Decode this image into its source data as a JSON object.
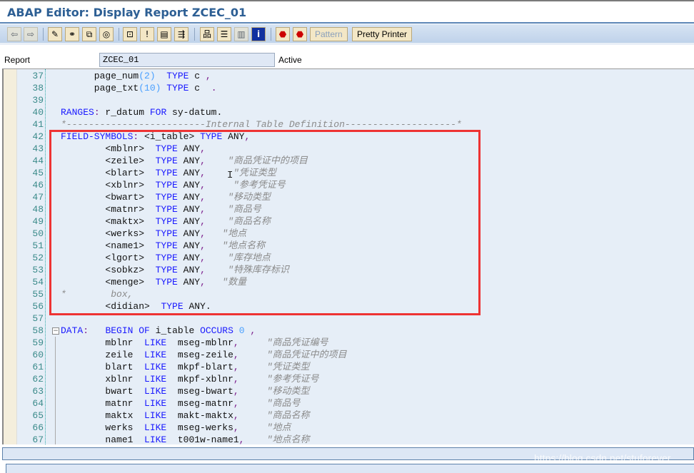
{
  "window": {
    "title": "ABAP Editor: Display Report ZCEC_01"
  },
  "toolbar": {
    "icons": [
      "back-icon",
      "forward-icon",
      "display-change-icon",
      "active-inactive-icon",
      "other-object-icon",
      "where-used-icon",
      "hierarchy-icon",
      "breakpoint-icon",
      "display-object-list-icon",
      "navigation-icon",
      "object-tree-icon",
      "stack-icon",
      "layout-icon",
      "info-icon",
      "stop-icon",
      "user-stop-icon"
    ],
    "pattern_label": "Pattern",
    "pretty_printer_label": "Pretty Printer"
  },
  "report": {
    "label": "Report",
    "value": "ZCEC_01",
    "status": "Active"
  },
  "editor": {
    "lines": [
      {
        "n": "37",
        "t": [
          [
            "",
            "      page_num"
          ],
          [
            "nu",
            "(2)"
          ],
          [
            "",
            "  "
          ],
          [
            "kw",
            "TYPE"
          ],
          [
            "",
            " c "
          ],
          [
            "pu",
            ","
          ]
        ]
      },
      {
        "n": "38",
        "t": [
          [
            "",
            "      page_txt"
          ],
          [
            "nu",
            "(10)"
          ],
          [
            "",
            " "
          ],
          [
            "kw",
            "TYPE"
          ],
          [
            "",
            " c  "
          ],
          [
            "pu",
            "."
          ]
        ]
      },
      {
        "n": "39",
        "t": []
      },
      {
        "n": "40",
        "t": [
          [
            "kw",
            "RANGES"
          ],
          [
            "pu",
            ":"
          ],
          [
            "",
            " r_datum "
          ],
          [
            "kw",
            "FOR"
          ],
          [
            "",
            " sy-datum."
          ]
        ]
      },
      {
        "n": "41",
        "t": [
          [
            "cm",
            "*-------------------------Internal Table Definition--------------------*"
          ]
        ]
      },
      {
        "n": "42",
        "t": [
          [
            "kw",
            "FIELD-SYMBOLS"
          ],
          [
            "pu",
            ":"
          ],
          [
            "",
            " <i_table> "
          ],
          [
            "kw",
            "TYPE"
          ],
          [
            "",
            " ANY"
          ],
          [
            "pu",
            ","
          ]
        ]
      },
      {
        "n": "43",
        "t": [
          [
            "",
            "        <mblnr>  "
          ],
          [
            "kw",
            "TYPE"
          ],
          [
            "",
            " ANY"
          ],
          [
            "pu",
            ","
          ]
        ]
      },
      {
        "n": "44",
        "t": [
          [
            "",
            "        <zeile>  "
          ],
          [
            "kw",
            "TYPE"
          ],
          [
            "",
            " ANY"
          ],
          [
            "pu",
            ","
          ],
          [
            "",
            "    "
          ],
          [
            "cm",
            "\"商品凭证中的项目"
          ]
        ]
      },
      {
        "n": "45",
        "t": [
          [
            "",
            "        <blart>  "
          ],
          [
            "kw",
            "TYPE"
          ],
          [
            "",
            " ANY"
          ],
          [
            "pu",
            ","
          ],
          [
            "",
            "     "
          ],
          [
            "cm",
            "\"凭证类型"
          ]
        ]
      },
      {
        "n": "46",
        "t": [
          [
            "",
            "        <xblnr>  "
          ],
          [
            "kw",
            "TYPE"
          ],
          [
            "",
            " ANY"
          ],
          [
            "pu",
            ","
          ],
          [
            "",
            "     "
          ],
          [
            "cm",
            "\"参考凭证号"
          ]
        ]
      },
      {
        "n": "47",
        "t": [
          [
            "",
            "        <bwart>  "
          ],
          [
            "kw",
            "TYPE"
          ],
          [
            "",
            " ANY"
          ],
          [
            "pu",
            ","
          ],
          [
            "",
            "    "
          ],
          [
            "cm",
            "\"移动类型"
          ]
        ]
      },
      {
        "n": "48",
        "t": [
          [
            "",
            "        <matnr>  "
          ],
          [
            "kw",
            "TYPE"
          ],
          [
            "",
            " ANY"
          ],
          [
            "pu",
            ","
          ],
          [
            "",
            "    "
          ],
          [
            "cm",
            "\"商品号"
          ]
        ]
      },
      {
        "n": "49",
        "t": [
          [
            "",
            "        <maktx>  "
          ],
          [
            "kw",
            "TYPE"
          ],
          [
            "",
            " ANY"
          ],
          [
            "pu",
            ","
          ],
          [
            "",
            "    "
          ],
          [
            "cm",
            "\"商品名称"
          ]
        ]
      },
      {
        "n": "50",
        "t": [
          [
            "",
            "        <werks>  "
          ],
          [
            "kw",
            "TYPE"
          ],
          [
            "",
            " ANY"
          ],
          [
            "pu",
            ","
          ],
          [
            "",
            "   "
          ],
          [
            "cm",
            "\"地点"
          ]
        ]
      },
      {
        "n": "51",
        "t": [
          [
            "",
            "        <name1>  "
          ],
          [
            "kw",
            "TYPE"
          ],
          [
            "",
            " ANY"
          ],
          [
            "pu",
            ","
          ],
          [
            "",
            "   "
          ],
          [
            "cm",
            "\"地点名称"
          ]
        ]
      },
      {
        "n": "52",
        "t": [
          [
            "",
            "        <lgort>  "
          ],
          [
            "kw",
            "TYPE"
          ],
          [
            "",
            " ANY"
          ],
          [
            "pu",
            ","
          ],
          [
            "",
            "    "
          ],
          [
            "cm",
            "\"库存地点"
          ]
        ]
      },
      {
        "n": "53",
        "t": [
          [
            "",
            "        <sobkz>  "
          ],
          [
            "kw",
            "TYPE"
          ],
          [
            "",
            " ANY"
          ],
          [
            "pu",
            ","
          ],
          [
            "",
            "    "
          ],
          [
            "cm",
            "\"特殊库存标识"
          ]
        ]
      },
      {
        "n": "54",
        "t": [
          [
            "",
            "        <menge>  "
          ],
          [
            "kw",
            "TYPE"
          ],
          [
            "",
            " ANY"
          ],
          [
            "pu",
            ","
          ],
          [
            "",
            "   "
          ],
          [
            "cm",
            "\"数量"
          ]
        ]
      },
      {
        "n": "55",
        "t": [
          [
            "cm",
            "*        box,"
          ]
        ]
      },
      {
        "n": "56",
        "t": [
          [
            "",
            "        <didian>  "
          ],
          [
            "kw",
            "TYPE"
          ],
          [
            "",
            " ANY."
          ]
        ]
      },
      {
        "n": "57",
        "t": []
      },
      {
        "n": "58",
        "t": [
          [
            "kw",
            "DATA"
          ],
          [
            "pu",
            ":"
          ],
          [
            "",
            "   "
          ],
          [
            "kw",
            "BEGIN OF"
          ],
          [
            "",
            " i_table "
          ],
          [
            "kw",
            "OCCURS"
          ],
          [
            "",
            " "
          ],
          [
            "nu",
            "0"
          ],
          [
            "",
            " "
          ],
          [
            "pu",
            ","
          ]
        ]
      },
      {
        "n": "59",
        "t": [
          [
            "",
            "        mblnr  "
          ],
          [
            "kw",
            "LIKE"
          ],
          [
            "",
            "  mseg-mblnr"
          ],
          [
            "pu",
            ","
          ],
          [
            "",
            "     "
          ],
          [
            "cm",
            "\"商品凭证编号"
          ]
        ]
      },
      {
        "n": "60",
        "t": [
          [
            "",
            "        zeile  "
          ],
          [
            "kw",
            "LIKE"
          ],
          [
            "",
            "  mseg-zeile"
          ],
          [
            "pu",
            ","
          ],
          [
            "",
            "     "
          ],
          [
            "cm",
            "\"商品凭证中的项目"
          ]
        ]
      },
      {
        "n": "61",
        "t": [
          [
            "",
            "        blart  "
          ],
          [
            "kw",
            "LIKE"
          ],
          [
            "",
            "  mkpf-blart"
          ],
          [
            "pu",
            ","
          ],
          [
            "",
            "     "
          ],
          [
            "cm",
            "\"凭证类型"
          ]
        ]
      },
      {
        "n": "62",
        "t": [
          [
            "",
            "        xblnr  "
          ],
          [
            "kw",
            "LIKE"
          ],
          [
            "",
            "  mkpf-xblnr"
          ],
          [
            "pu",
            ","
          ],
          [
            "",
            "     "
          ],
          [
            "cm",
            "\"参考凭证号"
          ]
        ]
      },
      {
        "n": "63",
        "t": [
          [
            "",
            "        bwart  "
          ],
          [
            "kw",
            "LIKE"
          ],
          [
            "",
            "  mseg-bwart"
          ],
          [
            "pu",
            ","
          ],
          [
            "",
            "     "
          ],
          [
            "cm",
            "\"移动类型"
          ]
        ]
      },
      {
        "n": "64",
        "t": [
          [
            "",
            "        matnr  "
          ],
          [
            "kw",
            "LIKE"
          ],
          [
            "",
            "  mseg-matnr"
          ],
          [
            "pu",
            ","
          ],
          [
            "",
            "     "
          ],
          [
            "cm",
            "\"商品号"
          ]
        ]
      },
      {
        "n": "65",
        "t": [
          [
            "",
            "        maktx  "
          ],
          [
            "kw",
            "LIKE"
          ],
          [
            "",
            "  makt-maktx"
          ],
          [
            "pu",
            ","
          ],
          [
            "",
            "     "
          ],
          [
            "cm",
            "\"商品名称"
          ]
        ]
      },
      {
        "n": "66",
        "t": [
          [
            "",
            "        werks  "
          ],
          [
            "kw",
            "LIKE"
          ],
          [
            "",
            "  mseg-werks"
          ],
          [
            "pu",
            ","
          ],
          [
            "",
            "     "
          ],
          [
            "cm",
            "\"地点"
          ]
        ]
      },
      {
        "n": "67",
        "t": [
          [
            "",
            "        name1  "
          ],
          [
            "kw",
            "LIKE"
          ],
          [
            "",
            "  t001w-name1"
          ],
          [
            "pu",
            ","
          ],
          [
            "",
            "    "
          ],
          [
            "cm",
            "\"地点名称"
          ]
        ]
      }
    ]
  },
  "colors": {
    "keyword": "#1a1aff",
    "comment": "#8a8a8a",
    "number": "#4aa0ff",
    "punct": "#7a1a8a",
    "highlight_box": "#ee3333",
    "title": "#2d5f94"
  },
  "watermark": "https://blog.csdn.net/stuforever"
}
